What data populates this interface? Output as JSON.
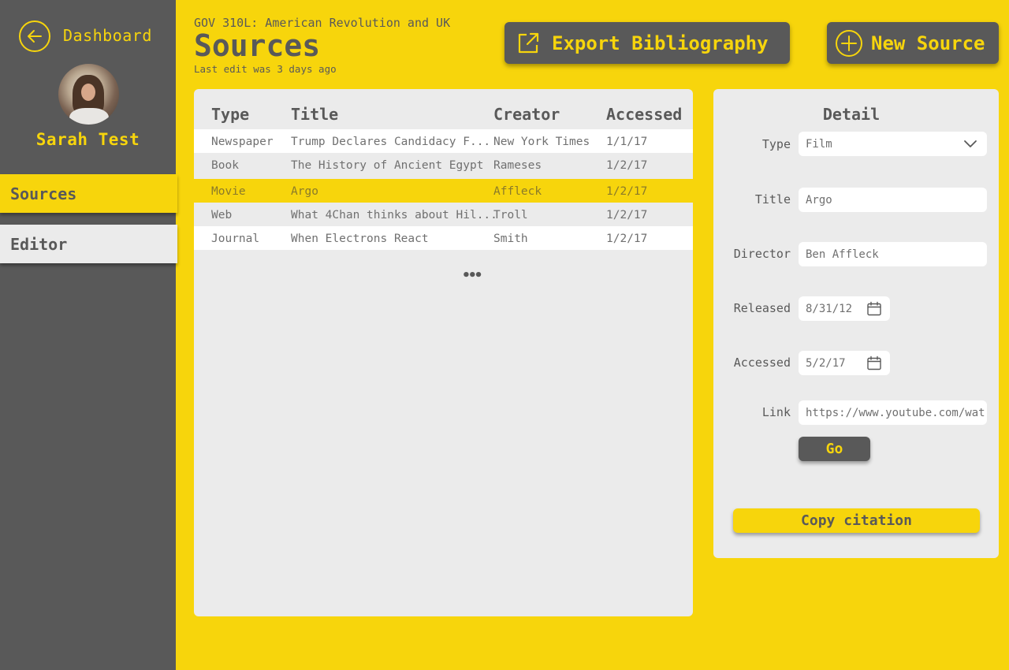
{
  "sidebar": {
    "back_label": "Dashboard",
    "user_name": "Sarah Test",
    "nav": [
      {
        "label": "Sources",
        "active": true
      },
      {
        "label": "Editor",
        "active": false
      }
    ]
  },
  "header": {
    "course": "GOV 310L: American Revolution and UK",
    "title": "Sources",
    "last_edit": "Last edit was 3 days ago",
    "export_label": "Export Bibliography",
    "new_source_label": "New Source"
  },
  "table": {
    "columns": [
      "Type",
      "Title",
      "Creator",
      "Accessed"
    ],
    "rows": [
      {
        "type": "Newspaper",
        "title": "Trump Declares Candidacy F...",
        "creator": "New York Times",
        "accessed": "1/1/17"
      },
      {
        "type": "Book",
        "title": "The History of Ancient Egypt",
        "creator": "Rameses",
        "accessed": "1/2/17"
      },
      {
        "type": "Movie",
        "title": "Argo",
        "creator": "Affleck",
        "accessed": "1/2/17"
      },
      {
        "type": "Web",
        "title": "What 4Chan thinks about Hil...",
        "creator": "Troll",
        "accessed": "1/2/17"
      },
      {
        "type": "Journal",
        "title": "When Electrons React",
        "creator": "Smith",
        "accessed": "1/2/17"
      }
    ],
    "selected_row": 2,
    "more": "•••"
  },
  "detail": {
    "title": "Detail",
    "fields": {
      "type": {
        "label": "Type",
        "value": "Film"
      },
      "title": {
        "label": "Title",
        "value": "Argo"
      },
      "director": {
        "label": "Director",
        "value": "Ben Affleck"
      },
      "released": {
        "label": "Released",
        "value": "8/31/12"
      },
      "accessed": {
        "label": "Accessed",
        "value": "5/2/17"
      },
      "link": {
        "label": "Link",
        "value": "https://www.youtube.com/wat"
      }
    },
    "go_label": "Go",
    "copy_label": "Copy citation"
  },
  "colors": {
    "accent": "#F7D50C",
    "dark": "#595959",
    "panel": "#EBEBEB"
  },
  "icons": [
    "arrow-left-icon",
    "external-link-icon",
    "plus-circle-icon",
    "chevron-down-icon",
    "calendar-icon"
  ]
}
